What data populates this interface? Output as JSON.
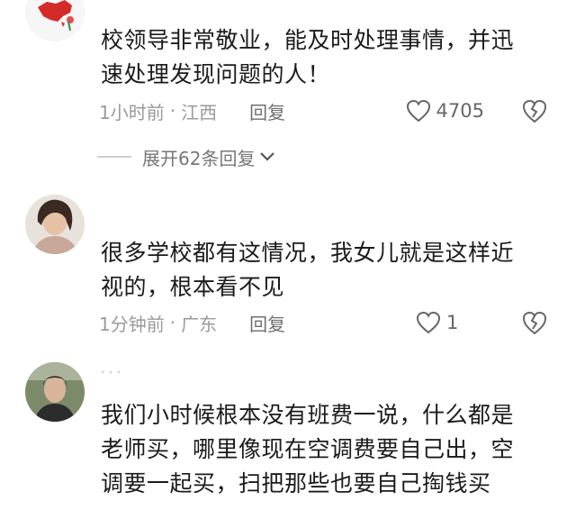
{
  "comments": [
    {
      "text_line1": "校领导非常敬业，能及时处理事情，并迅",
      "text_line2": "速处理发现问题的人！",
      "time": "1小时前",
      "location": "江西",
      "reply_label": "回复",
      "likes": "4705",
      "expand_label": "展开62条回复"
    },
    {
      "text_line1": "很多学校都有这情况，我女儿就是这样近",
      "text_line2": "视的，根本看不见",
      "time": "1分钟前",
      "location": "广东",
      "reply_label": "回复",
      "likes": "1"
    },
    {
      "username": "· · ·",
      "text_line1": "我们小时候根本没有班费一说，什么都是",
      "text_line2": "老师买，哪里像现在空调费要自己出，空",
      "text_line3": "调要一起买，扫把那些也要自己掏钱买"
    }
  ],
  "separator": "·",
  "icons": {
    "like": "heart-outline-icon",
    "dislike": "broken-heart-icon",
    "expand": "chevron-down-icon"
  },
  "colors": {
    "text": "#1b1b1b",
    "meta": "#9a9a9a",
    "icon": "#666666"
  }
}
